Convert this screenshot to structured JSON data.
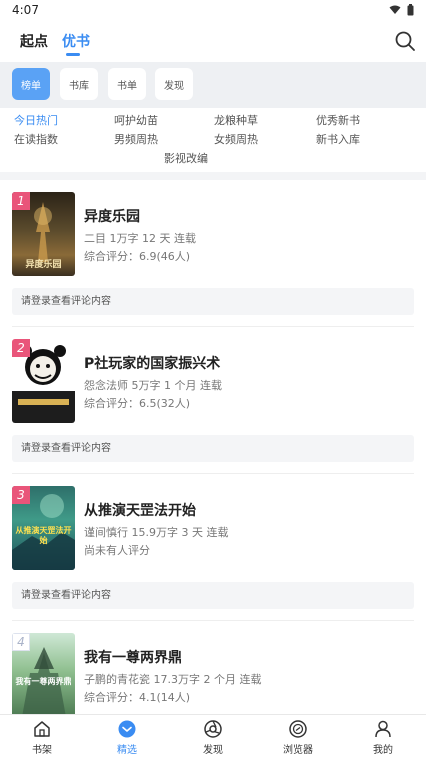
{
  "status": {
    "time": "4:07"
  },
  "top_tabs": [
    {
      "label": "起点"
    },
    {
      "label": "优书"
    }
  ],
  "categories": [
    {
      "label": "榜单",
      "active": true
    },
    {
      "label": "书库",
      "active": false
    },
    {
      "label": "书单",
      "active": false
    },
    {
      "label": "发现",
      "active": false
    }
  ],
  "sub_categories": [
    {
      "label": "今日热门",
      "active": true
    },
    {
      "label": "呵护幼苗"
    },
    {
      "label": "龙粮种草"
    },
    {
      "label": "优秀新书"
    },
    {
      "label": "在读指数"
    },
    {
      "label": "男频周热"
    },
    {
      "label": "女频周热"
    },
    {
      "label": "新书入库"
    },
    {
      "label": "影视改编"
    }
  ],
  "books": [
    {
      "rank": "1",
      "title": "异度乐园",
      "meta": "二目 1万字 12 天 连载",
      "score": "综合评分：6.9(46人)",
      "comment": "请登录查看评论内容",
      "cover_text": "异度乐园"
    },
    {
      "rank": "2",
      "title": "P社玩家的国家振兴术",
      "meta": "怨念法师 5万字 1 个月 连载",
      "score": "综合评分：6.5(32人)",
      "comment": "请登录查看评论内容",
      "cover_text": ""
    },
    {
      "rank": "3",
      "title": "从推演天罡法开始",
      "meta": "谨间慎行 15.9万字 3 天 连载",
      "score": "尚未有人评分",
      "comment": "请登录查看评论内容",
      "cover_text": "从推演天罡法开始"
    },
    {
      "rank": "4",
      "title": "我有一尊两界鼎",
      "meta": "子鹏的青花瓷 17.3万字 2 个月 连载",
      "score": "综合评分：4.1(14人)",
      "comment": "",
      "cover_text": "我有一尊两界鼎"
    }
  ],
  "bottom_nav": [
    {
      "label": "书架",
      "icon": "home-icon"
    },
    {
      "label": "精选",
      "icon": "featured-icon",
      "active": true
    },
    {
      "label": "发现",
      "icon": "discover-icon"
    },
    {
      "label": "浏览器",
      "icon": "browser-icon"
    },
    {
      "label": "我的",
      "icon": "profile-icon"
    }
  ],
  "colors": {
    "accent": "#3a8cf2",
    "rank": "#e9557a",
    "bg": "#f3f4f6"
  }
}
